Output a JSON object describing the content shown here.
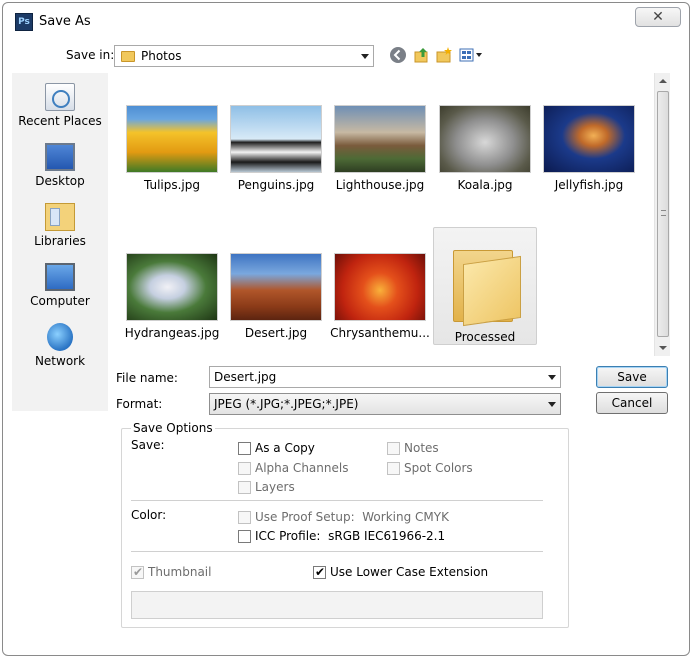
{
  "window": {
    "title": "Save As",
    "app_icon": "Ps",
    "close_glyph": "✕"
  },
  "toolbar": {
    "save_in_label": "Save in:",
    "location": "Photos",
    "icons": [
      "back-icon",
      "up-folder-icon",
      "new-folder-icon",
      "view-menu-icon"
    ]
  },
  "places": [
    {
      "label": "Recent Places",
      "icon": "recent-places-icon"
    },
    {
      "label": "Desktop",
      "icon": "desktop-icon"
    },
    {
      "label": "Libraries",
      "icon": "libraries-icon"
    },
    {
      "label": "Computer",
      "icon": "computer-icon"
    },
    {
      "label": "Network",
      "icon": "network-icon"
    }
  ],
  "files": [
    {
      "name": "Tulips.jpg"
    },
    {
      "name": "Penguins.jpg"
    },
    {
      "name": "Lighthouse.jpg"
    },
    {
      "name": "Koala.jpg"
    },
    {
      "name": "Jellyfish.jpg"
    },
    {
      "name": "Hydrangeas.jpg"
    },
    {
      "name": "Desert.jpg"
    },
    {
      "name": "Chrysanthemu..."
    },
    {
      "name": "Processed",
      "type": "folder",
      "selected": true
    }
  ],
  "form": {
    "file_name_label": "File name:",
    "file_name_value": "Desert.jpg",
    "format_label": "Format:",
    "format_value": "JPEG (*.JPG;*.JPEG;*.JPE)",
    "save_button": "Save",
    "cancel_button": "Cancel"
  },
  "save_options": {
    "legend": "Save Options",
    "save_label": "Save:",
    "as_a_copy": {
      "label": "As a Copy",
      "checked": false,
      "enabled": true
    },
    "notes": {
      "label": "Notes",
      "checked": false,
      "enabled": false
    },
    "alpha_channels": {
      "label": "Alpha Channels",
      "checked": false,
      "enabled": false
    },
    "spot_colors": {
      "label": "Spot Colors",
      "checked": false,
      "enabled": false
    },
    "layers": {
      "label": "Layers",
      "checked": false,
      "enabled": false
    },
    "color_label": "Color:",
    "use_proof_setup": {
      "label": "Use Proof Setup:",
      "value": "Working CMYK",
      "checked": false,
      "enabled": false
    },
    "icc_profile": {
      "label": "ICC Profile:",
      "value": "sRGB IEC61966-2.1",
      "checked": false,
      "enabled": true
    },
    "thumbnail": {
      "label": "Thumbnail",
      "checked": true,
      "enabled": false
    },
    "lower_case_ext": {
      "label": "Use Lower Case Extension",
      "checked": true,
      "enabled": true
    }
  }
}
